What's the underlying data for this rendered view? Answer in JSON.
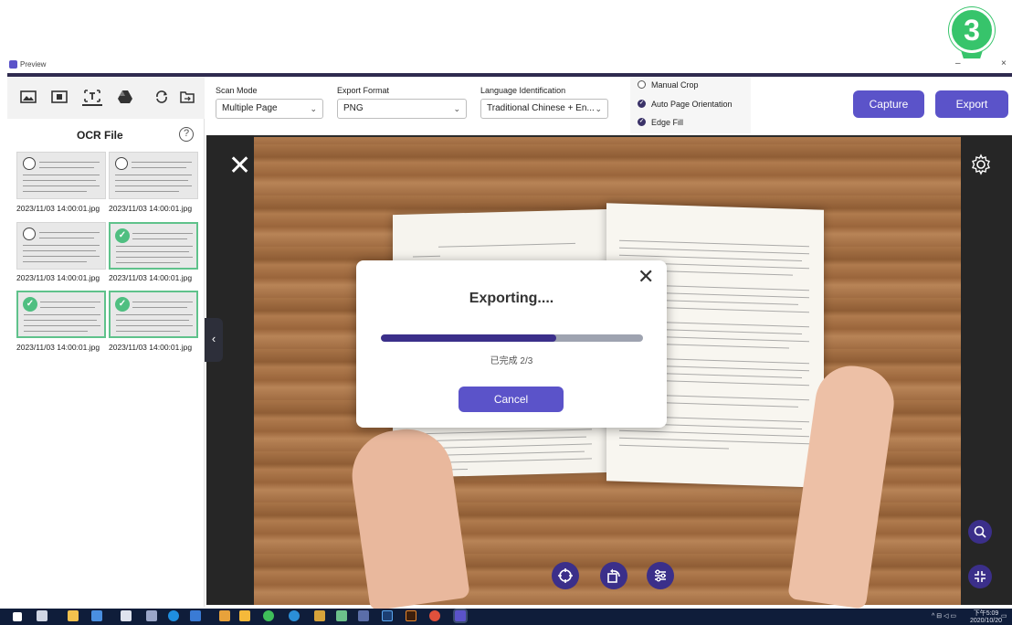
{
  "step": {
    "number": "3"
  },
  "window": {
    "title": "Preview",
    "minimize": "–",
    "close": "×"
  },
  "left_panel": {
    "tabs": [
      "image-icon",
      "video-icon",
      "ocr-text-icon",
      "cloud-drive-icon",
      "rotate-icon",
      "folder-icon"
    ],
    "title": "OCR File",
    "help": "?",
    "files": [
      {
        "name": "2023/11/03 14:00:01.jpg",
        "selected": false
      },
      {
        "name": "2023/11/03 14:00:01.jpg",
        "selected": false
      },
      {
        "name": "2023/11/03 14:00:01.jpg",
        "selected": false
      },
      {
        "name": "2023/11/03 14:00:01.jpg",
        "selected": true
      },
      {
        "name": "2023/11/03 14:00:01.jpg",
        "selected": true
      },
      {
        "name": "2023/11/03 14:00:01.jpg",
        "selected": true
      }
    ],
    "collapse": "‹"
  },
  "toolbar": {
    "scan_mode": {
      "label": "Scan Mode",
      "value": "Multiple Page"
    },
    "export_format": {
      "label": "Export Format",
      "value": "PNG"
    },
    "language": {
      "label": "Language Identification",
      "value": "Traditional Chinese + En..."
    },
    "options": [
      {
        "label": "Manual Crop",
        "checked": false
      },
      {
        "label": "Auto Page Orientation",
        "checked": true
      },
      {
        "label": "Edge Fill",
        "checked": true
      }
    ],
    "capture_label": "Capture",
    "export_label": "Export"
  },
  "viewer": {
    "close": "✕",
    "bottom_tools": [
      "target-icon",
      "rotate-page-icon",
      "adjust-icon"
    ],
    "side_tools": [
      "zoom-icon",
      "crop-icon"
    ]
  },
  "modal": {
    "close": "✕",
    "title": "Exporting....",
    "progress": 0.67,
    "progress_text": "已完成 2/3",
    "cancel_label": "Cancel"
  },
  "colors": {
    "accent": "#5b53c9",
    "dark_accent": "#3b2f8a",
    "step_badge": "#37c46b",
    "selected_border": "#5fc28b"
  },
  "taskbar": {
    "apps": [
      "start-icon",
      "task-view-icon",
      "file-explorer-icon",
      "people-icon",
      "calculator-icon",
      "app-icon",
      "edge-icon",
      "app-icon",
      "app-icon",
      "app-icon",
      "line-icon",
      "skype-icon",
      "app-icon",
      "app-icon",
      "app-icon",
      "photoshop-icon",
      "illustrator-icon",
      "chrome-icon",
      "preview-app-icon"
    ],
    "time": "下午5:09",
    "date": "2020/10/20"
  }
}
